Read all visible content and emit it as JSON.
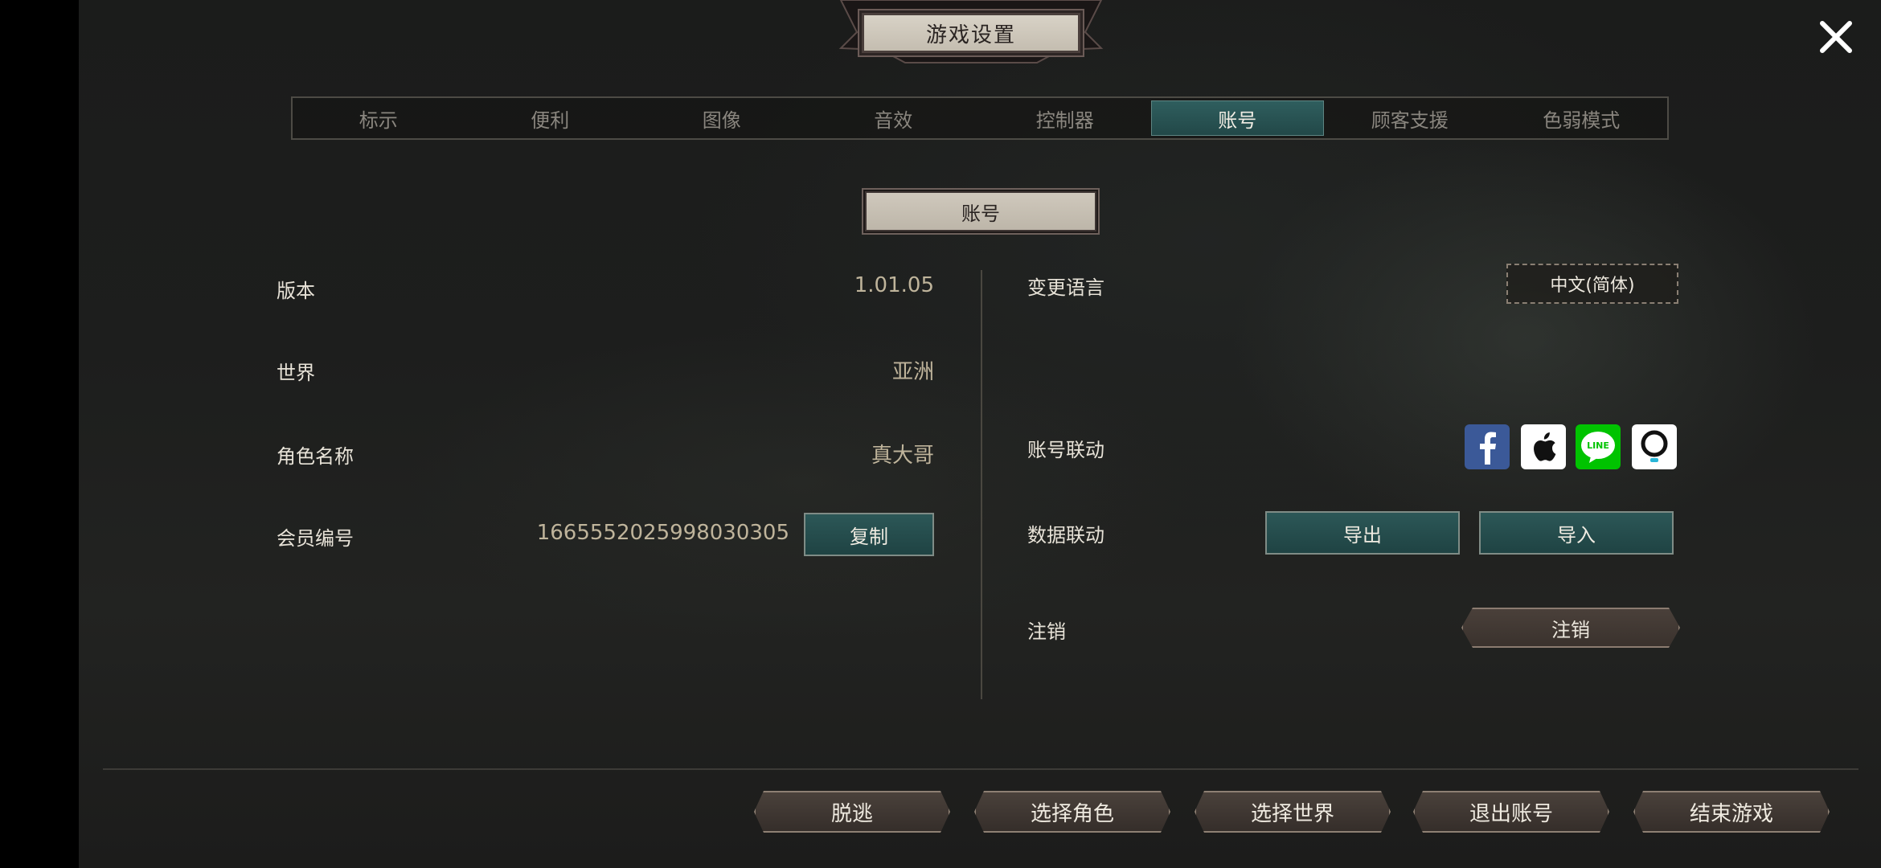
{
  "header": {
    "title": "游戏设置"
  },
  "tabs": [
    {
      "label": "标示"
    },
    {
      "label": "便利"
    },
    {
      "label": "图像"
    },
    {
      "label": "音效"
    },
    {
      "label": "控制器"
    },
    {
      "label": "账号",
      "active": true
    },
    {
      "label": "顾客支援"
    },
    {
      "label": "色弱模式"
    }
  ],
  "section": {
    "title": "账号"
  },
  "info": {
    "version_label": "版本",
    "version_value": "1.01.05",
    "world_label": "世界",
    "world_value": "亚洲",
    "character_label": "角色名称",
    "character_value": "真大哥",
    "member_label": "会员编号",
    "member_value": "1665552025998030305",
    "copy_label": "复制"
  },
  "settings": {
    "language_label": "变更语言",
    "language_value": "中文(简体)",
    "link_label": "账号联动",
    "data_link_label": "数据联动",
    "export_label": "导出",
    "import_label": "导入",
    "cancel_label": "注销",
    "cancel_button": "注销"
  },
  "social_icons": [
    "facebook-icon",
    "apple-icon",
    "line-icon",
    "onestore-icon"
  ],
  "bottom_buttons": {
    "escape": "脱逃",
    "select_character": "选择角色",
    "select_world": "选择世界",
    "logout": "退出账号",
    "quit": "结束游戏"
  },
  "colors": {
    "accent_teal": "#2c5757",
    "facebook": "#3b5998",
    "line": "#00c300"
  }
}
